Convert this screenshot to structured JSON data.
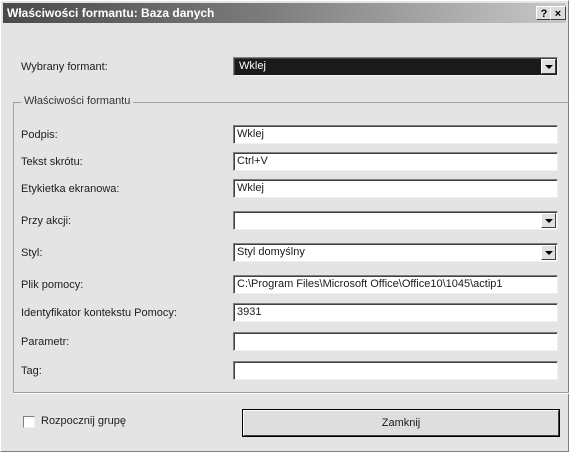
{
  "window": {
    "title": "Właściwości formantu: Baza danych",
    "help_button": "?",
    "close_button": "×"
  },
  "selected_control": {
    "label": "Wybrany formant:",
    "value": "Wklej"
  },
  "group": {
    "legend": "Właściwości formantu",
    "fields": [
      {
        "label": "Podpis:",
        "value": "Wklej",
        "type": "text"
      },
      {
        "label": "Tekst skrótu:",
        "value": "Ctrl+V",
        "type": "text"
      },
      {
        "label": "Etykietka ekranowa:",
        "value": "Wklej",
        "type": "text"
      },
      {
        "label": "Przy akcji:",
        "value": "",
        "type": "combo"
      },
      {
        "label": "Styl:",
        "value": "Styl domyślny",
        "type": "combo"
      },
      {
        "label": "Plik pomocy:",
        "value": "C:\\Program Files\\Microsoft Office\\Office10\\1045\\actip1",
        "type": "text"
      },
      {
        "label": "Identyfikator kontekstu Pomocy:",
        "value": "3931",
        "type": "text"
      },
      {
        "label": "Parametr:",
        "value": "",
        "type": "text"
      },
      {
        "label": "Tag:",
        "value": "",
        "type": "text"
      }
    ]
  },
  "begin_group": {
    "label": "Rozpocznij grupę",
    "checked": false
  },
  "close_label": "Zamknij"
}
